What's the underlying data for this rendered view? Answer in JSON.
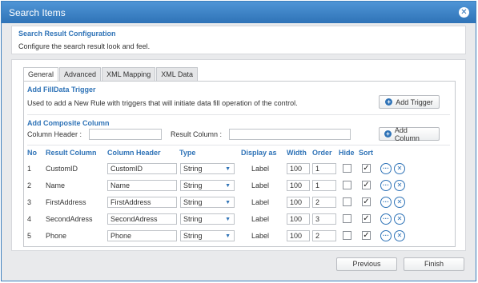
{
  "window": {
    "title": "Search Items"
  },
  "header": {
    "title": "Search Result Configuration",
    "description": "Configure the search result look and feel."
  },
  "tabs": [
    {
      "label": "General",
      "active": true
    },
    {
      "label": "Advanced",
      "active": false
    },
    {
      "label": "XML Mapping",
      "active": false
    },
    {
      "label": "XML Data",
      "active": false
    }
  ],
  "filldata": {
    "title": "Add FillData Trigger",
    "description": "Used to add a New Rule with triggers that will initiate data fill operation of the control.",
    "button_label": "Add Trigger"
  },
  "composite": {
    "title": "Add Composite Column",
    "column_header_label": "Column Header :",
    "column_header_value": "",
    "result_column_label": "Result Column :",
    "result_column_value": "",
    "button_label": "Add Column"
  },
  "table": {
    "headers": {
      "no": "No",
      "result_column": "Result Column",
      "column_header": "Column Header",
      "type": "Type",
      "display_as": "Display as",
      "width": "Width",
      "order": "Order",
      "hide": "Hide",
      "sort": "Sort"
    },
    "rows": [
      {
        "no": "1",
        "result_column": "CustomID",
        "column_header": "CustomID",
        "type": "String",
        "display_as": "Label",
        "width": "100",
        "order": "1",
        "hide": false,
        "sort": true
      },
      {
        "no": "2",
        "result_column": "Name",
        "column_header": "Name",
        "type": "String",
        "display_as": "Label",
        "width": "100",
        "order": "1",
        "hide": false,
        "sort": true
      },
      {
        "no": "3",
        "result_column": "FirstAddress",
        "column_header": "FirstAddress",
        "type": "String",
        "display_as": "Label",
        "width": "100",
        "order": "2",
        "hide": false,
        "sort": true
      },
      {
        "no": "4",
        "result_column": "SecondAdress",
        "column_header": "SecondAdress",
        "type": "String",
        "display_as": "Label",
        "width": "100",
        "order": "3",
        "hide": false,
        "sort": true
      },
      {
        "no": "5",
        "result_column": "Phone",
        "column_header": "Phone",
        "type": "String",
        "display_as": "Label",
        "width": "100",
        "order": "2",
        "hide": false,
        "sort": true
      }
    ]
  },
  "footer": {
    "previous_label": "Previous",
    "finish_label": "Finish"
  },
  "icons": {
    "close": "close-icon",
    "add": "plus-circle-icon",
    "more": "ellipsis-icon",
    "delete": "remove-icon",
    "dropdown": "chevron-down-icon"
  },
  "colors": {
    "accent": "#2f73b7",
    "titlebar": "#3a80c4"
  }
}
